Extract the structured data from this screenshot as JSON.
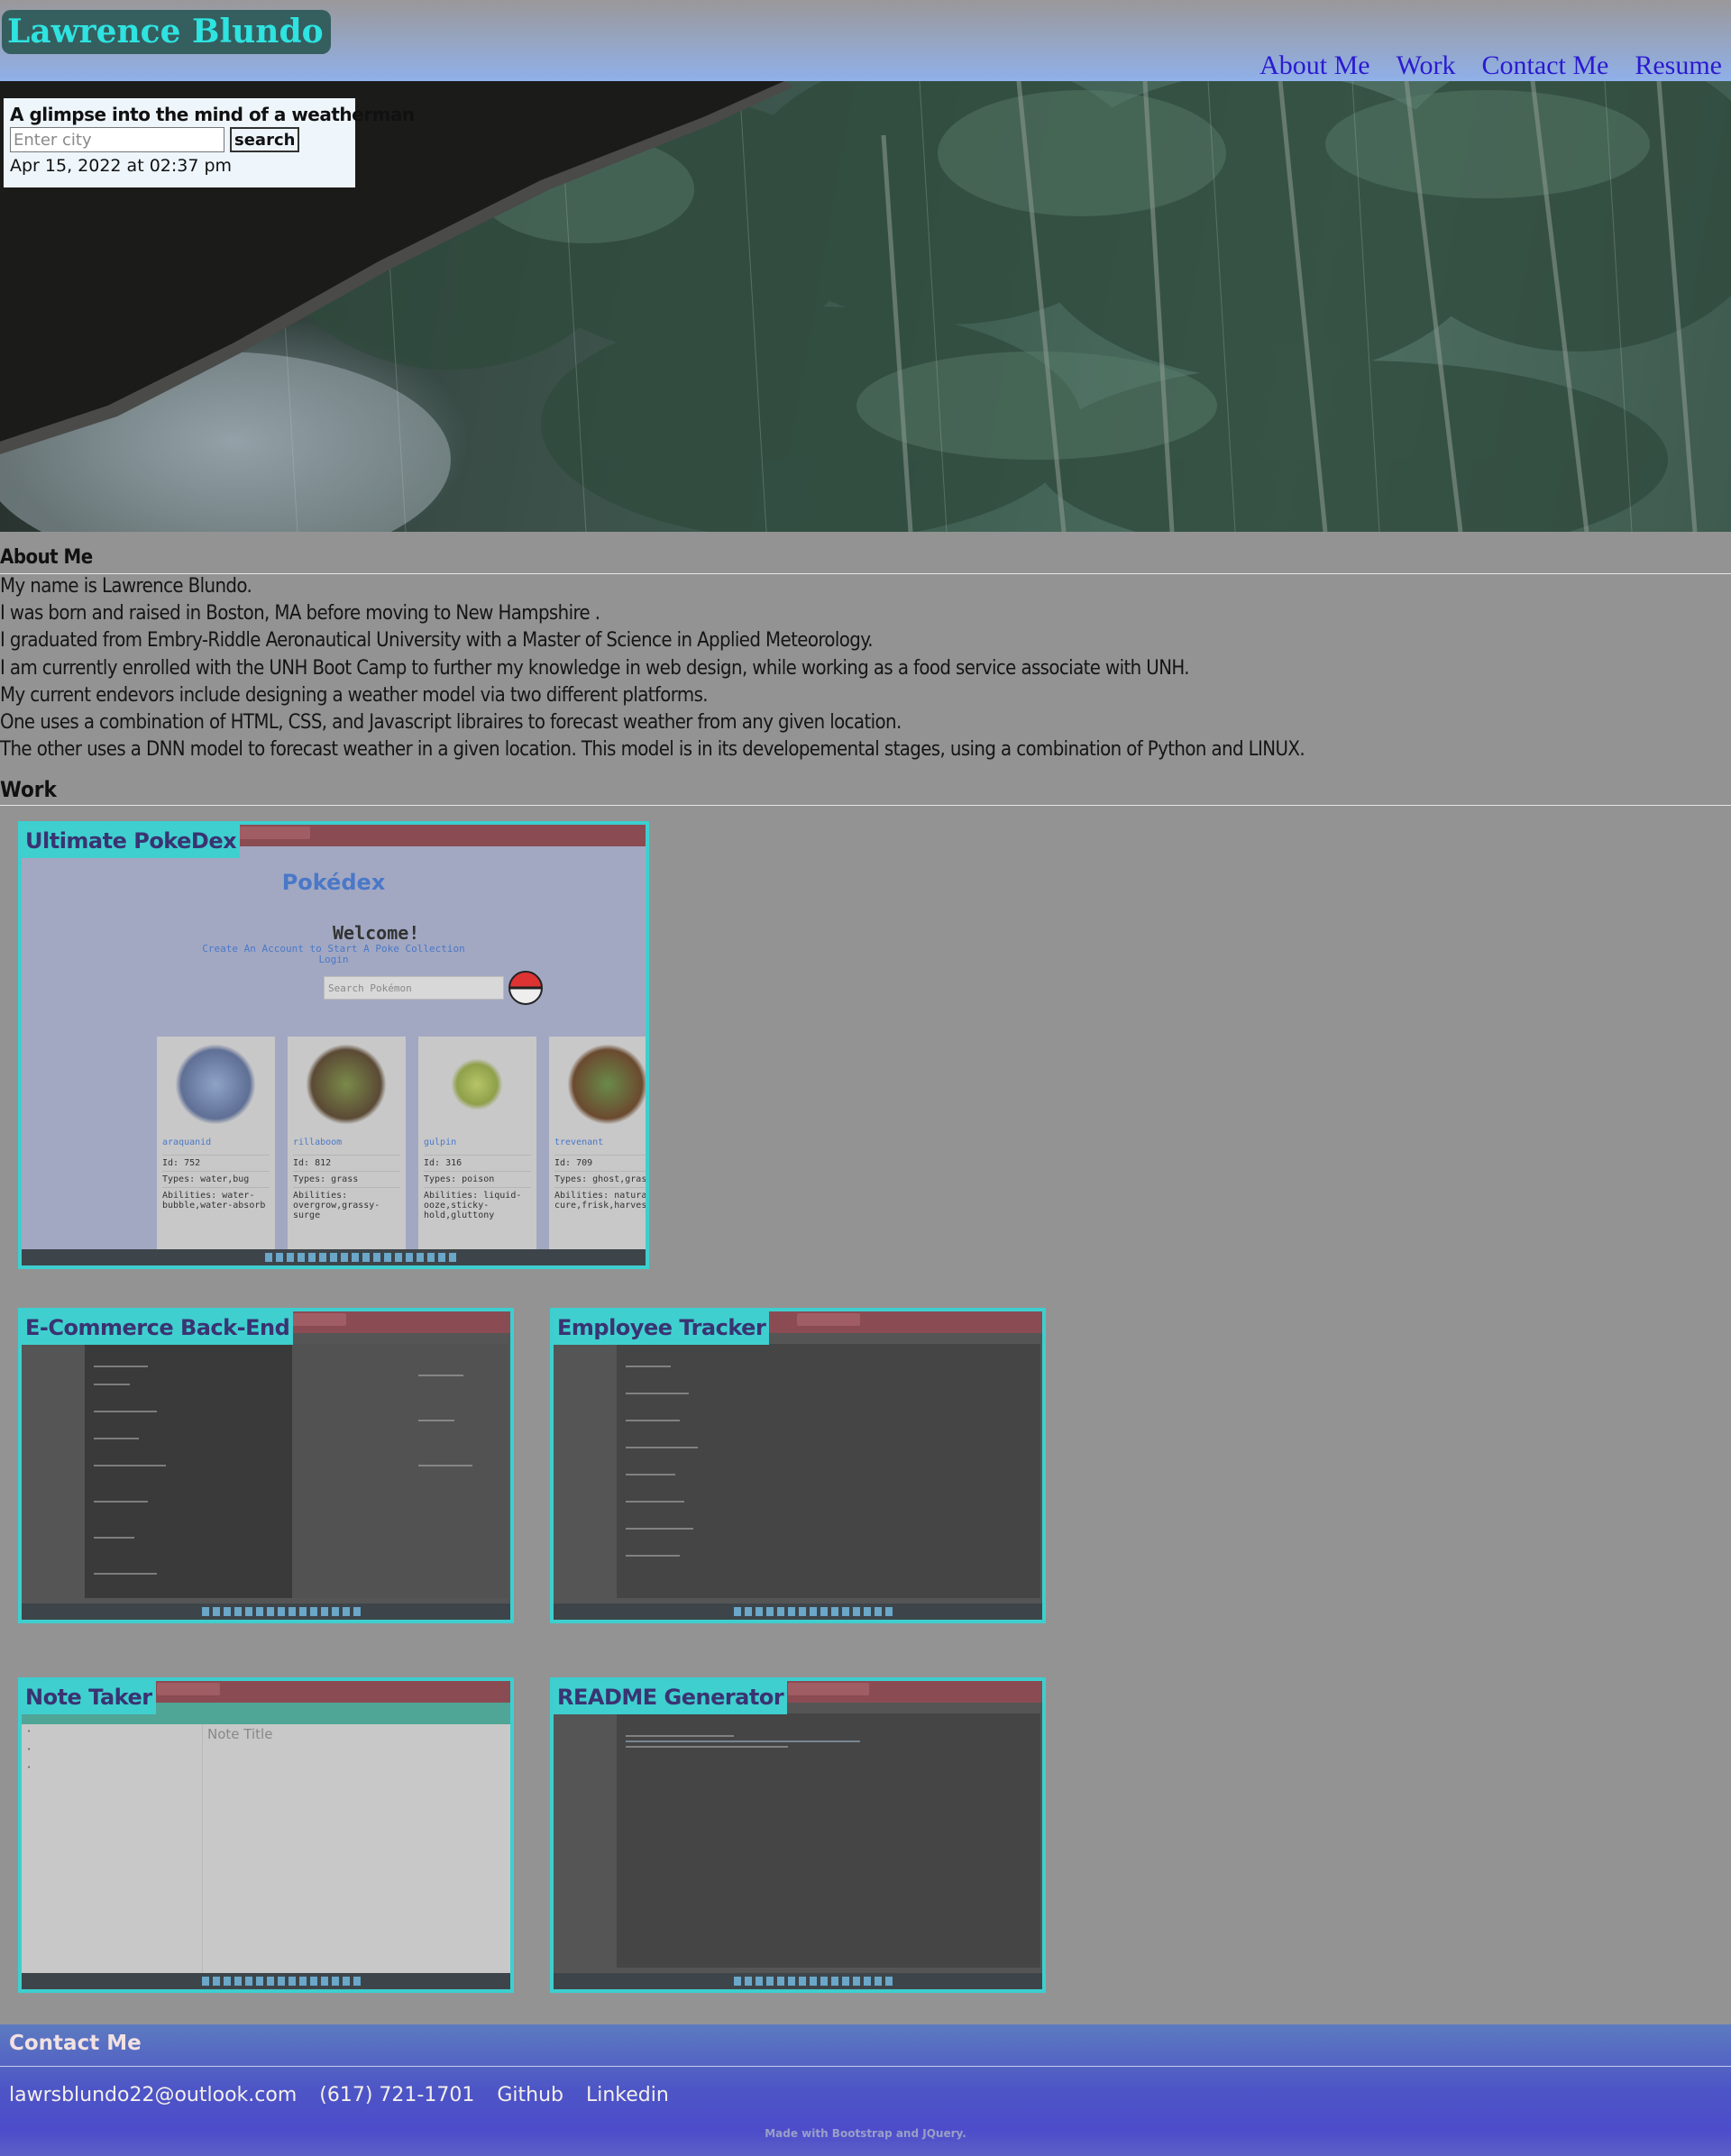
{
  "header": {
    "site_title": "Lawrence Blundo",
    "nav": [
      "About Me",
      "Work",
      "Contact Me",
      "Resume"
    ]
  },
  "weather": {
    "title": "A glimpse into the mind of a weatherman",
    "city_placeholder": "Enter city",
    "search_label": "search",
    "datetime": "Apr 15, 2022 at 02:37 pm"
  },
  "about": {
    "heading": "About Me",
    "lines": [
      "My name is Lawrence Blundo.",
      "I was born and raised in Boston, MA before moving to New Hampshire .",
      "I graduated from Embry-Riddle Aeronautical University with a Master of Science in Applied Meteorology.",
      "I am currently enrolled with the UNH Boot Camp to further my knowledge in web design, while working as a food service associate with UNH.",
      "My current endevors include designing a weather model via two different platforms.",
      "One uses a combination of HTML, CSS, and Javascript libraires to forecast weather from any given location.",
      "The other uses a DNN model to forecast weather in a given location. This model is in its developemental stages, using a combination of Python and LINUX."
    ]
  },
  "work": {
    "heading": "Work",
    "projects": [
      {
        "title": "Ultimate PokeDex"
      },
      {
        "title": "E-Commerce Back-End"
      },
      {
        "title": "Employee Tracker"
      },
      {
        "title": "Note Taker"
      },
      {
        "title": "README Generator"
      }
    ],
    "pokedex_screenshot": {
      "brand": "Pokédex",
      "welcome": "Welcome!",
      "subtitle_1": "Create An Account to Start A Poke Collection",
      "subtitle_2": "Login",
      "search_placeholder": "Search Pokémon",
      "cards": [
        {
          "name": "araquanid",
          "id": "Id: 752",
          "types": "Types: water,bug",
          "abilities": "Abilities: water-bubble,water-absorb"
        },
        {
          "name": "rillaboom",
          "id": "Id: 812",
          "types": "Types: grass",
          "abilities": "Abilities: overgrow,grassy-surge"
        },
        {
          "name": "gulpin",
          "id": "Id: 316",
          "types": "Types: poison",
          "abilities": "Abilities: liquid-ooze,sticky-hold,gluttony"
        },
        {
          "name": "trevenant",
          "id": "Id: 709",
          "types": "Types: ghost,grass",
          "abilities": "Abilities: natural-cure,frisk,harvest"
        }
      ]
    },
    "note_screenshot": {
      "note_title_placeholder": "Note Title"
    }
  },
  "contact": {
    "heading": "Contact Me",
    "email": "lawrsblundo22@outlook.com",
    "phone": "(617) 721-1701",
    "github": "Github",
    "linkedin": "Linkedin",
    "footer": "Made with Bootstrap and JQuery."
  },
  "colors": {
    "accent_cyan": "#3dcfcf",
    "title_cyan": "#2ee3e0",
    "nav_link": "#2b1bd0",
    "page_bg": "#939394",
    "contact_bg": "#4d55c6"
  }
}
